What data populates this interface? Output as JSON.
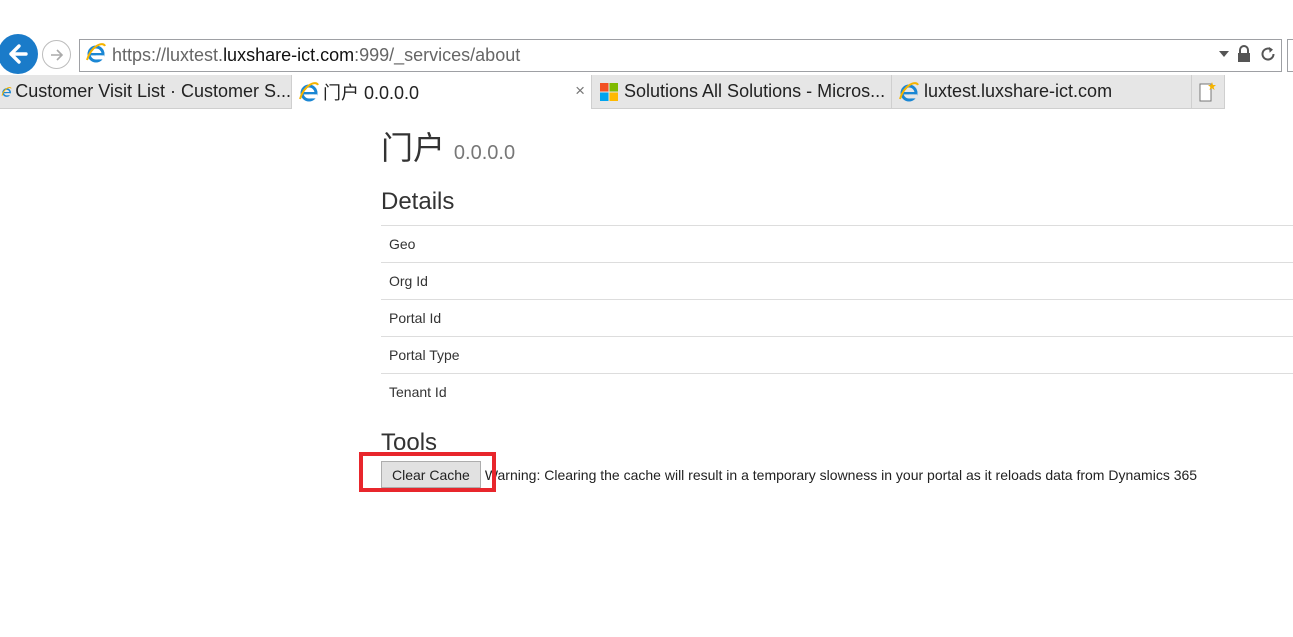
{
  "browser": {
    "url_scheme": "https://",
    "url_sub": "luxtest.",
    "url_host": "luxshare-ict.com",
    "url_path": ":999/_services/about",
    "tabs": [
      {
        "title": "Customer Visit List · Customer S..."
      },
      {
        "title": "门户 0.0.0.0",
        "close": "×"
      },
      {
        "title": "Solutions All Solutions - Micros..."
      },
      {
        "title": "luxtest.luxshare-ict.com"
      }
    ],
    "icons": [
      "back-arrow-icon",
      "forward-arrow-icon",
      "ie-logo-icon",
      "dropdown-caret-icon",
      "lock-icon",
      "refresh-icon",
      "windows-logo-icon",
      "new-tab-icon"
    ]
  },
  "page": {
    "title": "门户",
    "version": "0.0.0.0",
    "details_heading": "Details",
    "details_rows": [
      "Geo",
      "Org Id",
      "Portal Id",
      "Portal Type",
      "Tenant Id"
    ],
    "tools_heading": "Tools",
    "clear_cache_label": "Clear Cache",
    "warning": "Warning: Clearing the cache will result in a temporary slowness in your portal as it reloads data from Dynamics 365"
  },
  "colors": {
    "highlight": "#e8262c",
    "back_button": "#1a7bc9"
  }
}
